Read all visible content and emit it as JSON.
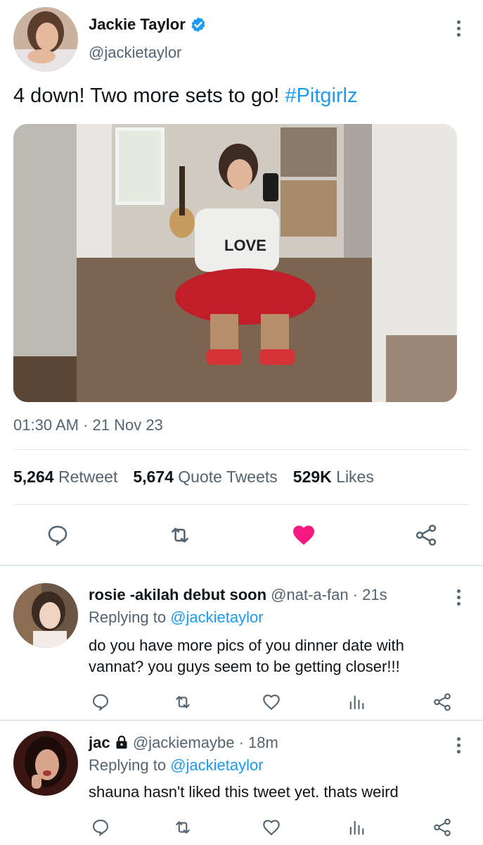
{
  "tweet": {
    "author_name": "Jackie Taylor",
    "author_handle": "@jackietaylor",
    "text": "4 down! Two more sets to go! ",
    "hashtag": "#Pitgirlz",
    "timestamp": "01:30 AM · 21 Nov 23",
    "stats": {
      "retweets_count": "5,264",
      "retweets_label": "Retweet",
      "quotes_count": "5,674",
      "quotes_label": "Quote Tweets",
      "likes_count": "529K",
      "likes_label": "Likes"
    },
    "liked": true
  },
  "replies": [
    {
      "name": "rosie -akilah debut soon",
      "meta": "@nat-a-fan · 21s",
      "replying_prefix": "Replying to ",
      "replying_to": "@jackietaylor",
      "text_line1": "do you have more pics of you dinner date with",
      "text_line2": "vannat? you guys seem to be getting closer!!!"
    },
    {
      "name": "jac",
      "meta": "@jackiemaybe · 18m",
      "replying_prefix": "Replying to ",
      "replying_to": "@jackietaylor",
      "text_line1": "shauna hasn't liked this tweet yet. thats weird",
      "locked": true
    }
  ],
  "colors": {
    "accent": "#1d9bf0",
    "like": "#f91880",
    "text": "#0f1419",
    "secondary": "#536471",
    "divider": "#e1e8ed"
  },
  "icons": [
    "verified-badge-icon",
    "more-icon",
    "reply-icon",
    "retweet-icon",
    "like-icon",
    "share-icon",
    "analytics-icon",
    "lock-icon"
  ]
}
